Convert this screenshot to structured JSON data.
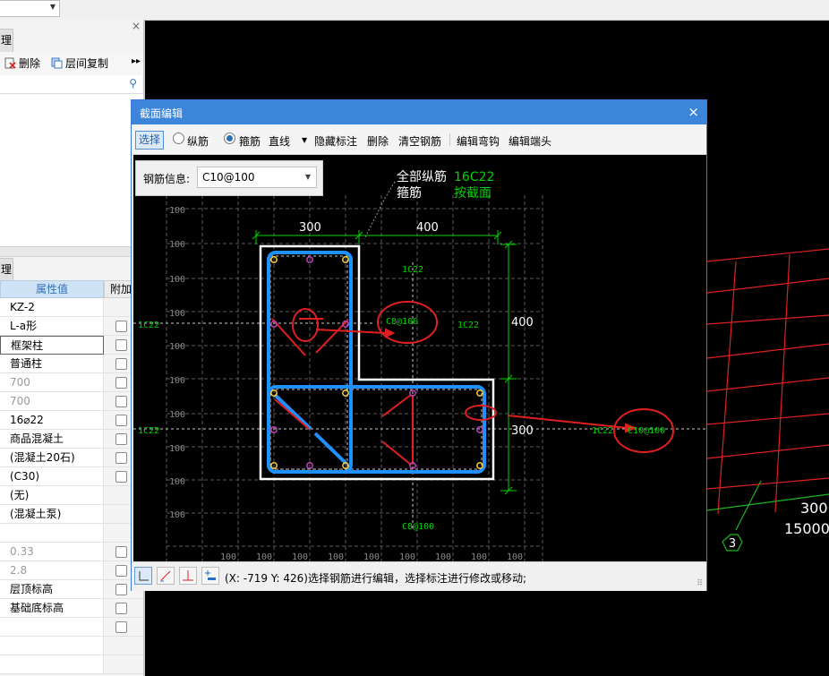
{
  "top": {
    "combo_value": ""
  },
  "left_panel": {
    "tab_top": "理",
    "tab_props": "理",
    "toolbar": {
      "delete": "删除",
      "floor_copy": "层间复制",
      "more": "▸▸"
    },
    "close": "×",
    "prop_header": {
      "value": "属性值",
      "extra": "附加"
    },
    "props": [
      {
        "value": "KZ-2",
        "grey": false,
        "check": false
      },
      {
        "value": "L-a形",
        "grey": false,
        "check": true
      },
      {
        "value": "框架柱",
        "grey": false,
        "check": true,
        "selected": true
      },
      {
        "value": "普通柱",
        "grey": false,
        "check": true
      },
      {
        "value": "700",
        "grey": true,
        "check": true
      },
      {
        "value": "700",
        "grey": true,
        "check": true
      },
      {
        "value": "16⌀22",
        "grey": false,
        "check": true
      },
      {
        "value": "商品混凝土",
        "grey": false,
        "check": true
      },
      {
        "value": "(混凝土20石)",
        "grey": false,
        "check": true
      },
      {
        "value": "(C30)",
        "grey": false,
        "check": true
      },
      {
        "value": "(无)",
        "grey": false,
        "check": false
      },
      {
        "value": "(混凝土泵)",
        "grey": false,
        "check": false
      },
      {
        "value": "",
        "grey": false,
        "check": false
      },
      {
        "value": "0.33",
        "grey": true,
        "check": true
      },
      {
        "value": "2.8",
        "grey": true,
        "check": true
      },
      {
        "value": "层顶标高",
        "grey": false,
        "check": true
      },
      {
        "value": "基础底标高",
        "grey": false,
        "check": true
      },
      {
        "value": "",
        "grey": false,
        "check": true
      },
      {
        "value": "",
        "grey": false,
        "check": false
      },
      {
        "value": "",
        "grey": false,
        "check": false
      }
    ]
  },
  "dialog": {
    "title": "截面编辑",
    "close": "×",
    "toolbar": {
      "select": "选择",
      "longitudinal": "纵筋",
      "stirrup": "箍筋",
      "line": "直线",
      "hide_dims": "隐藏标注",
      "delete": "删除",
      "clear": "清空钢筋",
      "edit_hook": "编辑弯钩",
      "edit_end": "编辑端头"
    },
    "rebar_info_label": "钢筋信息:",
    "rebar_info_value": "C10@100",
    "canvas": {
      "legend_all_long": "全部纵筋",
      "legend_all_long_val": "16C22",
      "legend_stirrup": "箍筋",
      "legend_stirrup_val": "按截面",
      "dim_300_top": "300",
      "dim_400_top": "400",
      "dim_400_right": "400",
      "dim_300_right": "300",
      "lbl_1c22_top": "1C22",
      "lbl_c8_top": "C8@100",
      "lbl_1c22_left1": "1C22",
      "lbl_1c22_right1": "1C22",
      "lbl_1c22_left2": "1C22",
      "lbl_1c22_right2": "1C22",
      "lbl_c10_right": "C10@100",
      "lbl_c8_bottom": "C8@100",
      "grid_label": "100"
    },
    "status_text": "(X: -719 Y: 426)选择钢筋进行编辑，选择标注进行修改或移动;"
  },
  "right_view": {
    "text_3000": "300",
    "text_15000": "15000",
    "axis_label": "3"
  },
  "colors": {
    "accent": "#3c85db",
    "rebar": "#1e90ff",
    "dim": "#00d400",
    "red": "#e02020"
  }
}
